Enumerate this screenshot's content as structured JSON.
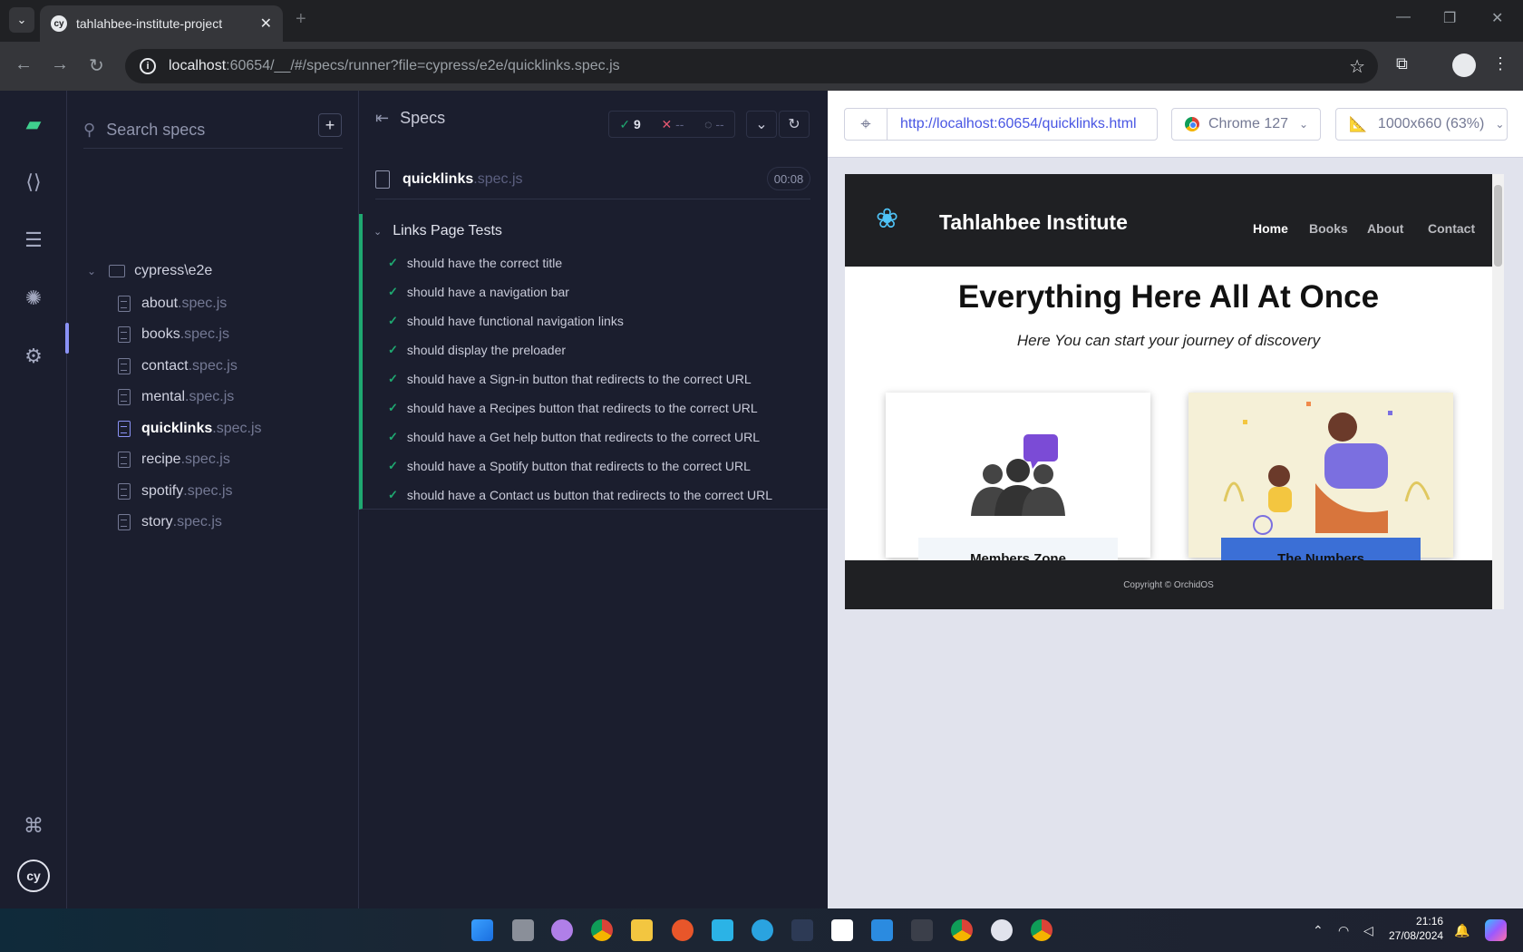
{
  "browser": {
    "tab_title": "tahlahbee-institute-project",
    "tab_favicon": "cy",
    "url_host": "localhost",
    "url_rest": ":60654/__/#/specs/runner?file=cypress/e2e/quicklinks.spec.js"
  },
  "sidebar": {
    "search_placeholder": "Search specs",
    "add_label": "+",
    "folder": "cypress\\e2e",
    "specs": [
      {
        "name": "about",
        "ext": ".spec.js"
      },
      {
        "name": "books",
        "ext": ".spec.js"
      },
      {
        "name": "contact",
        "ext": ".spec.js"
      },
      {
        "name": "mental",
        "ext": ".spec.js"
      },
      {
        "name": "quicklinks",
        "ext": ".spec.js"
      },
      {
        "name": "recipe",
        "ext": ".spec.js"
      },
      {
        "name": "spotify",
        "ext": ".spec.js"
      },
      {
        "name": "story",
        "ext": ".spec.js"
      }
    ]
  },
  "reporter": {
    "header": "Specs",
    "passed": "9",
    "failed": "--",
    "pending": "--",
    "spec_name": "quicklinks",
    "spec_ext": ".spec.js",
    "duration": "00:08",
    "suite": "Links Page Tests",
    "tests": [
      "should have the correct title",
      "should have a navigation bar",
      "should have functional navigation links",
      "should display the preloader",
      "should have a Sign-in button that redirects to the correct URL",
      "should have a Recipes button that redirects to the correct URL",
      "should have a Get help button that redirects to the correct URL",
      "should have a Spotify button that redirects to the correct URL",
      "should have a Contact us button that redirects to the correct URL"
    ]
  },
  "aut": {
    "url": "http://localhost:60654/quicklinks.html",
    "browser": "Chrome 127",
    "viewport": "1000x660 (63%)"
  },
  "site": {
    "brand": "Tahlahbee Institute",
    "nav": [
      "Home",
      "Books",
      "About",
      "Contact"
    ],
    "hero_title": "Everything Here All At Once",
    "hero_sub": "Here You can start your journey of discovery",
    "card1_label": "Members Zone",
    "card2_label": "The Numbers",
    "footer": "Copyright © OrchidOS"
  },
  "taskbar": {
    "time": "21:16",
    "date": "27/08/2024"
  },
  "colors": {
    "pass": "#1fa971",
    "fail": "#e45770",
    "accent": "#8a92f5",
    "url_blue": "#4956e3"
  }
}
